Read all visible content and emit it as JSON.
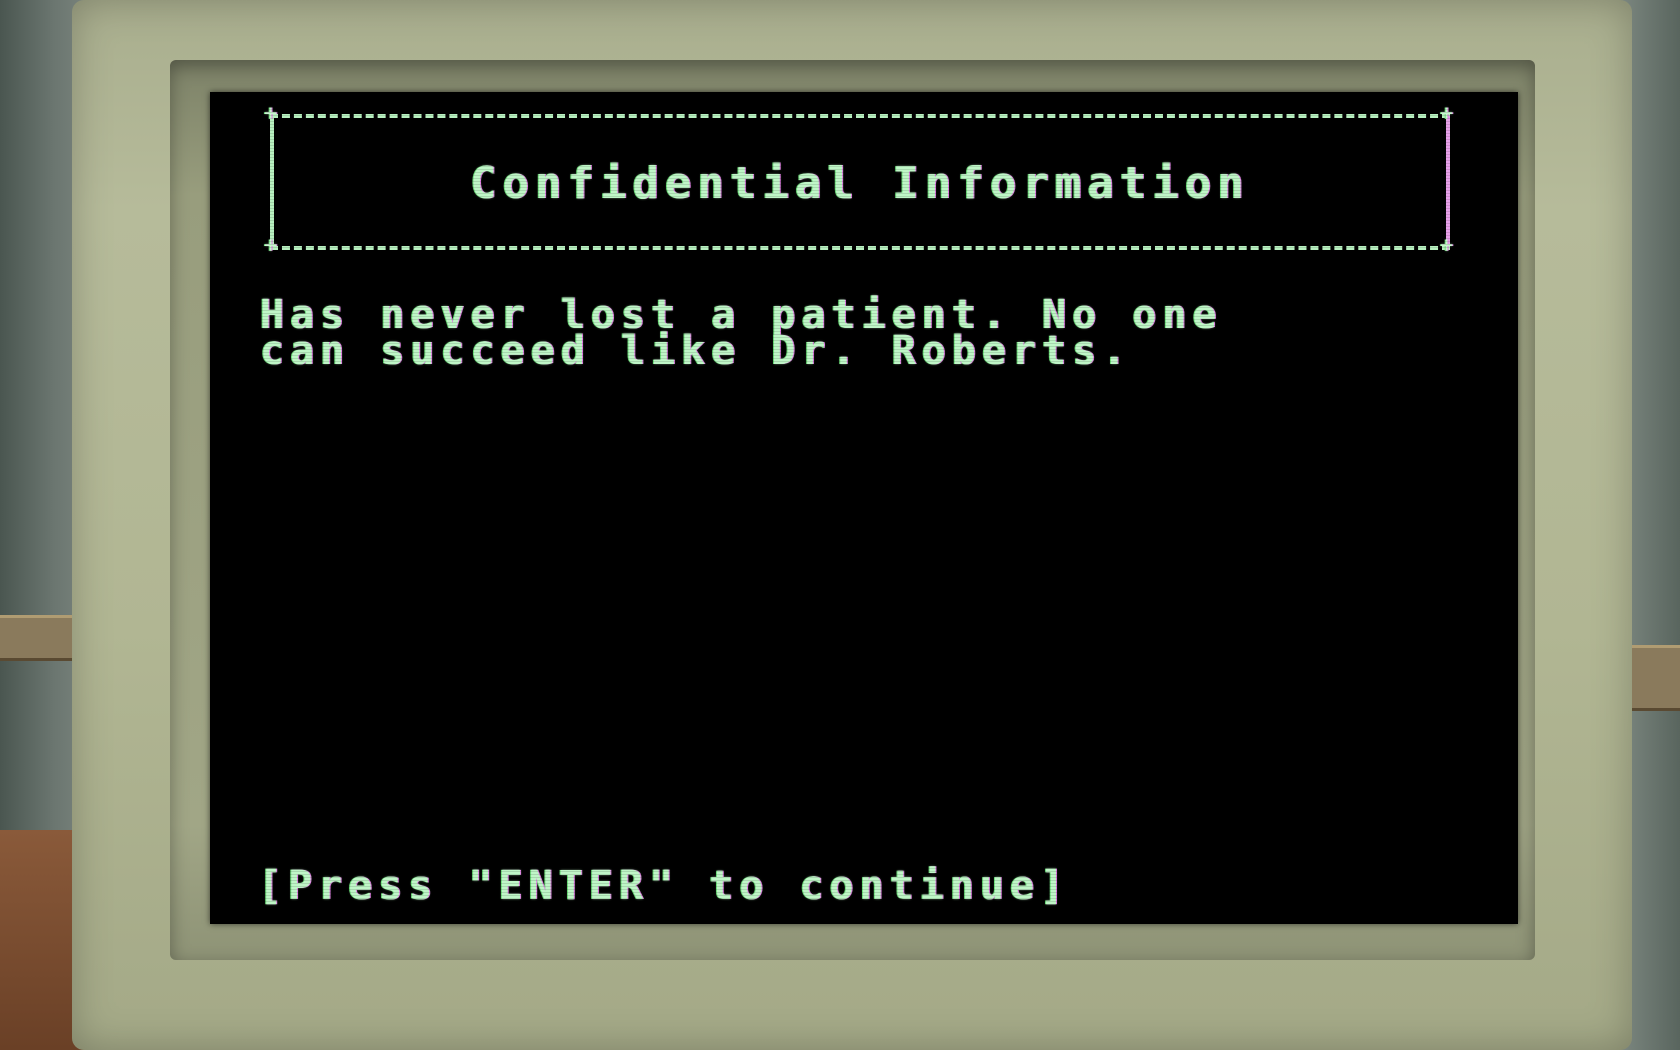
{
  "terminal": {
    "title": "Confidential Information",
    "body_line_1": "Has never lost a patient. No one",
    "body_line_2": "can succeed like Dr. Roberts.",
    "prompt": "[Press \"ENTER\" to continue]"
  },
  "colors": {
    "screen_background": "#000000",
    "text_green": "#a7f4b4",
    "text_magenta_fringe": "#e07de3",
    "monitor_casing": "#b1b693"
  }
}
